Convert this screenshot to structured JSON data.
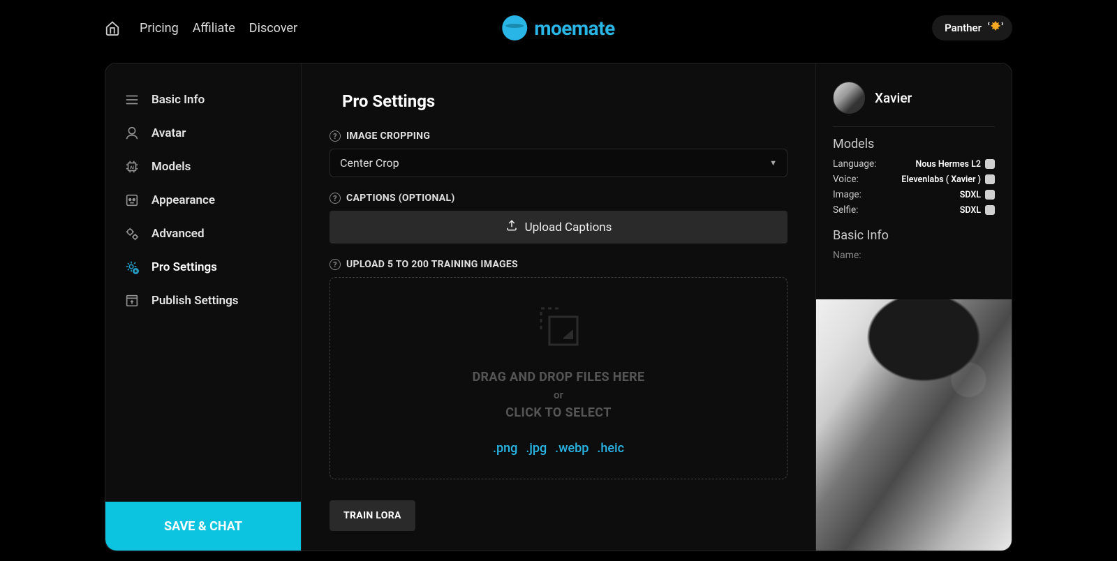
{
  "nav": {
    "pricing": "Pricing",
    "affiliate": "Affiliate",
    "discover": "Discover"
  },
  "brand": "moemate",
  "user": {
    "name": "Panther"
  },
  "sidebar": {
    "items": [
      {
        "label": "Basic Info"
      },
      {
        "label": "Avatar"
      },
      {
        "label": "Models"
      },
      {
        "label": "Appearance"
      },
      {
        "label": "Advanced"
      },
      {
        "label": "Pro Settings"
      },
      {
        "label": "Publish Settings"
      }
    ],
    "save": "SAVE & CHAT"
  },
  "main": {
    "title": "Pro Settings",
    "cropping_label": "IMAGE CROPPING",
    "cropping_value": "Center Crop",
    "captions_label": "CAPTIONS (OPTIONAL)",
    "upload_captions": "Upload Captions",
    "training_label": "UPLOAD 5 TO 200 TRAINING IMAGES",
    "drop_line1": "DRAG AND DROP FILES HERE",
    "drop_or": "or",
    "drop_line2": "CLICK TO SELECT",
    "extensions": [
      ".png",
      ".jpg",
      ".webp",
      ".heic"
    ],
    "train_btn": "TRAIN LORA"
  },
  "right": {
    "char_name": "Xavier",
    "models_title": "Models",
    "rows": [
      {
        "label": "Language:",
        "value": "Nous Hermes L2"
      },
      {
        "label": "Voice:",
        "value": "Elevenlabs ( Xavier )"
      },
      {
        "label": "Image:",
        "value": "SDXL"
      },
      {
        "label": "Selfie:",
        "value": "SDXL"
      }
    ],
    "basic_info_title": "Basic Info",
    "name_label": "Name:"
  }
}
